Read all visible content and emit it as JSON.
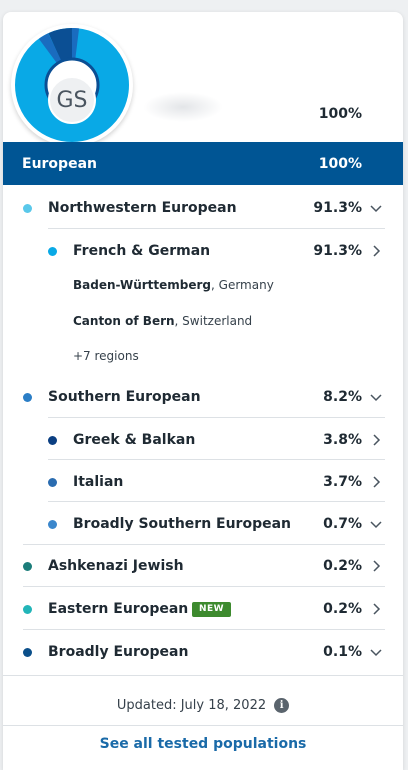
{
  "profile": {
    "initials": "GS",
    "total_percent": "100%",
    "donut_colors": [
      "#09a9e6",
      "#1a6cbf",
      "#0b4f94",
      "#4ab7e8"
    ]
  },
  "banner": {
    "label": "European",
    "percent": "100%"
  },
  "rows": {
    "nw": {
      "label": "Northwestern European",
      "percent": "91.3%",
      "color": "#5ac8ea"
    },
    "fg": {
      "label": "French & German",
      "percent": "91.3%",
      "color": "#09a9e6"
    },
    "se": {
      "label": "Southern European",
      "percent": "8.2%",
      "color": "#2b7ec6"
    },
    "gb": {
      "label": "Greek & Balkan",
      "percent": "3.8%",
      "color": "#0b3f82"
    },
    "it": {
      "label": "Italian",
      "percent": "3.7%",
      "color": "#2a6cb0"
    },
    "bs": {
      "label": "Broadly Southern European",
      "percent": "0.7%",
      "color": "#3b87cc"
    },
    "aj": {
      "label": "Ashkenazi Jewish",
      "percent": "0.2%",
      "color": "#1c7d7a"
    },
    "ee": {
      "label": "Eastern European",
      "percent": "0.2%",
      "color": "#22b5b8",
      "badge": "NEW"
    },
    "be": {
      "label": "Broadly European",
      "percent": "0.1%",
      "color": "#0b4f8a"
    }
  },
  "regions": {
    "r1_name": "Baden-Württemberg",
    "r1_country": ", Germany",
    "r2_name": "Canton of Bern",
    "r2_country": ", Switzerland",
    "more": "+7 regions"
  },
  "footer": {
    "updated": "Updated: July 18, 2022",
    "see_all": "See all tested populations"
  }
}
